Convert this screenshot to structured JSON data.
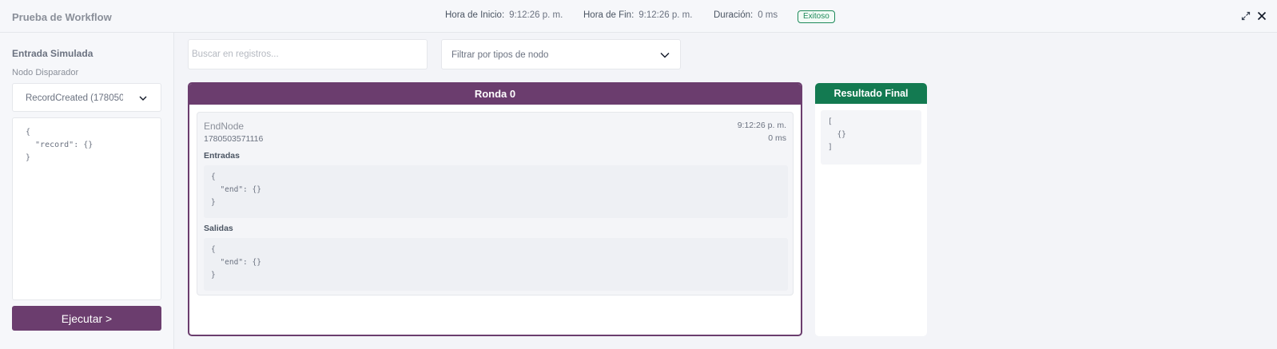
{
  "header": {
    "title": "Prueba de Workflow",
    "start_label": "Hora de Inicio:",
    "start_value": "9:12:26 p. m.",
    "end_label": "Hora de Fin:",
    "end_value": "9:12:26 p. m.",
    "duration_label": "Duración:",
    "duration_value": "0 ms",
    "status_badge": "Exitoso",
    "status_color": "#1e8a5a"
  },
  "sidebar": {
    "section_title": "Entrada Simulada",
    "trigger_label": "Nodo Disparador",
    "trigger_selected": "RecordCreated (17805035",
    "input_json": "{\n  \"record\": {}\n}",
    "run_button": "Ejecutar >"
  },
  "toolbar": {
    "search_placeholder": "Buscar en registros...",
    "filter_label": "Filtrar por tipos de nodo"
  },
  "round": {
    "title": "Ronda 0",
    "accent_color": "#6b3d6e",
    "node": {
      "name": "EndNode",
      "id": "1780503571116",
      "time": "9:12:26 p. m.",
      "duration": "0 ms",
      "inputs_label": "Entradas",
      "inputs_json": "{\n  \"end\": {}\n}",
      "outputs_label": "Salidas",
      "outputs_json": "{\n  \"end\": {}\n}"
    }
  },
  "final_result": {
    "title": "Resultado Final",
    "accent_color": "#137a51",
    "json": "[\n  {}\n]"
  },
  "icons": {
    "expand": "expand-icon",
    "close": "close-icon",
    "chevron": "chevron-down-icon"
  }
}
